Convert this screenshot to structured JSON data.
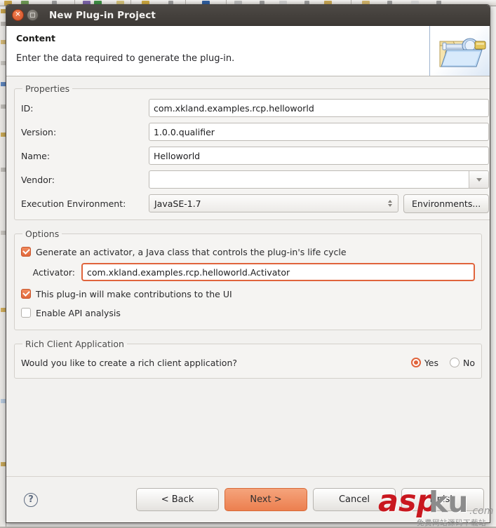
{
  "window": {
    "title": "New Plug-in Project",
    "close_icon": "close-icon",
    "maximize_icon": "maximize-icon"
  },
  "header": {
    "title": "Content",
    "description": "Enter the data required to generate the plug-in.",
    "icon": "plugin-folder-icon"
  },
  "properties": {
    "legend": "Properties",
    "fields": [
      {
        "label": "ID:",
        "value": "com.xkland.examples.rcp.helloworld",
        "placeholder": ""
      },
      {
        "label": "Version:",
        "value": "1.0.0.qualifier",
        "placeholder": ""
      },
      {
        "label": "Name:",
        "value": "Helloworld",
        "placeholder": ""
      }
    ],
    "vendor": {
      "label": "Vendor:",
      "value": "",
      "placeholder": "",
      "dropdown_icon": "chevron-down-icon"
    },
    "execution_environment": {
      "label": "Execution Environment:",
      "value": "JavaSE-1.7",
      "spinner_icon": "spinner-arrows-icon",
      "button_label": "Environments..."
    }
  },
  "options": {
    "legend": "Options",
    "generate_activator": {
      "label": "Generate an activator, a Java class that controls the plug-in's life cycle",
      "checked": true
    },
    "activator": {
      "label": "Activator:",
      "value": "com.xkland.examples.rcp.helloworld.Activator",
      "placeholder": "",
      "focused": true
    },
    "ui_contributions": {
      "label": "This plug-in will make contributions to the UI",
      "checked": true
    },
    "api_analysis": {
      "label": "Enable API analysis",
      "checked": false
    }
  },
  "rich_client": {
    "legend": "Rich Client Application",
    "question": "Would you like to create a rich client application?",
    "yes_label": "Yes",
    "no_label": "No",
    "selected": "Yes"
  },
  "footer": {
    "help_icon": "help-icon",
    "help_glyph": "?",
    "back_label": "< Back",
    "next_label": "Next >",
    "cancel_label": "Cancel",
    "finish_label": "Finish"
  },
  "watermark": {
    "part_red": "asp",
    "part_gray": "ku",
    "part_domain": ".com",
    "subtitle": "免费网站源码下载站"
  },
  "colors": {
    "accent_orange": "#e0643c",
    "primary_button": "#ec7f4f",
    "titlebar": "#453f3b",
    "dialog_bg": "#f2f1ef",
    "watermark_red": "#c9181f"
  }
}
